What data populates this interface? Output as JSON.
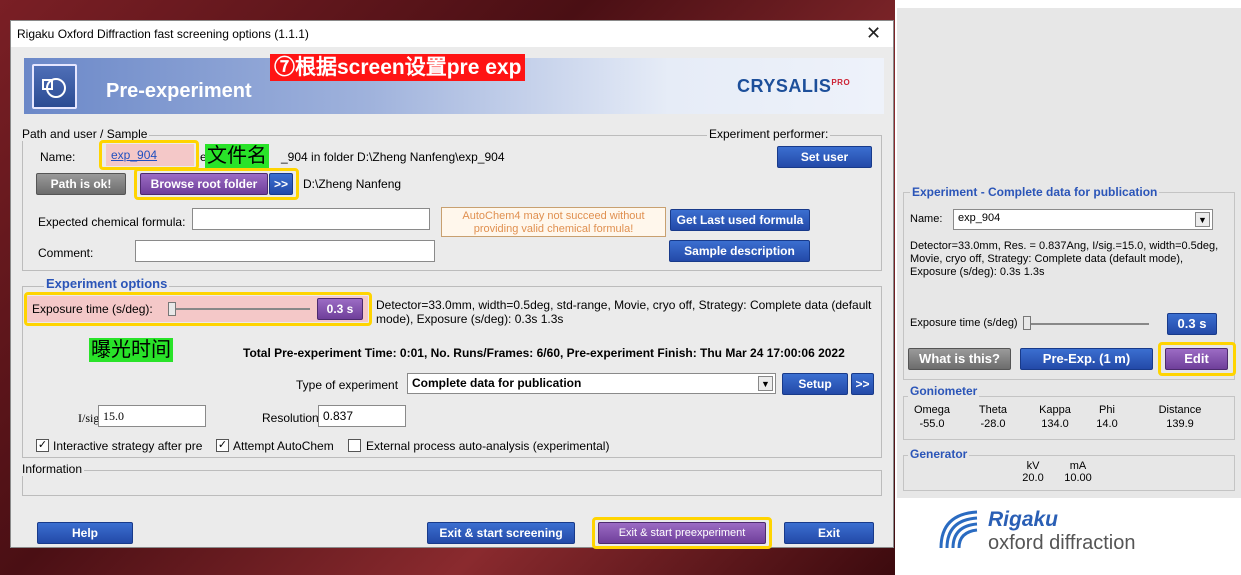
{
  "dialog": {
    "title": "Rigaku Oxford Diffraction fast screening options (1.1.1)",
    "close_icon": "close-icon",
    "banner_title": "Pre-experiment",
    "brand_logo": "CRYSALIS",
    "brand_sup": "PRO",
    "annotation_top": "⑦根据screen设置pre exp"
  },
  "path": {
    "group_label": "Path and user / Sample",
    "performer_label": "Experiment performer:",
    "name_label": "Name:",
    "name_value": "exp_904",
    "annotation_filename": "文件名",
    "path_desc": "exp_904 in folder D:\\Zheng Nanfeng\\exp_904",
    "path_desc_prefix": "e",
    "path_desc_suffix": "_904 in folder D:\\Zheng Nanfeng\\exp_904",
    "set_user": "Set user",
    "path_ok": "Path is ok!",
    "browse_root": "Browse root folder",
    "browse_more": ">>",
    "root_path": "D:\\Zheng Nanfeng",
    "formula_label": "Expected chemical formula:",
    "formula_value": "",
    "autochem_warning": "AutoChem4 may not succeed without providing valid chemical formula!",
    "last_formula": "Get Last used formula",
    "comment_label": "Comment:",
    "comment_value": "",
    "sample_desc": "Sample description"
  },
  "experiment": {
    "group_label": "Experiment options",
    "exposure_label": "Exposure time (s/deg):",
    "exposure_value": "0.3 s",
    "detector_text_1": "Detector=33.0mm, width=0.5deg, std-range, Movie, cryo off, Strategy: Complete data (default",
    "detector_text_2": "mode), Exposure (s/deg): 0.3s 1.3s",
    "annotation_exposure": "曝光时间",
    "total_text": "Total Pre-experiment Time: 0:01, No. Runs/Frames: 6/60, Pre-experiment Finish: Thu Mar 24 17:00:06 2022",
    "type_label": "Type of experiment",
    "type_value": "Complete data for publication",
    "setup": "Setup",
    "setup_more": ">>",
    "isig_label": "I/sig",
    "isig_value": "15.0",
    "resolution_label": "Resolution",
    "resolution_value": "0.837",
    "check_interactive": "Interactive strategy after pre",
    "check_autochem": "Attempt AutoChem",
    "check_external": "External process auto-analysis (experimental)",
    "checkmark": "✓"
  },
  "information": {
    "group_label": "Information"
  },
  "footer": {
    "help": "Help",
    "exit_screening": "Exit & start screening",
    "exit_preexp": "Exit & start preexperiment",
    "exit": "Exit"
  },
  "right_panel": {
    "experiment_header": "Experiment - Complete data for publication",
    "name_label": "Name:",
    "name_value": "exp_904",
    "details": "Detector=33.0mm, Res. = 0.837Ang, I/sig.=15.0, width=0.5deg, Movie, cryo off, Strategy: Complete data (default mode), Exposure (s/deg): 0.3s 1.3s",
    "exposure_label": "Exposure time (s/deg)",
    "exposure_value": "0.3 s",
    "what_is_this": "What is this?",
    "pre_exp": "Pre-Exp. (1 m)",
    "edit": "Edit",
    "goniometer_header": "Goniometer",
    "gonio_labels": [
      "Omega",
      "Theta",
      "Kappa",
      "Phi",
      "Distance"
    ],
    "gonio_values": [
      "-55.0",
      "-28.0",
      "134.0",
      "14.0",
      "139.9"
    ],
    "generator_header": "Generator",
    "gen_labels": [
      "kV",
      "mA"
    ],
    "gen_values": [
      "20.0",
      "10.00"
    ],
    "brand_name": "Rigaku",
    "brand_sub": "oxford diffraction"
  },
  "colors": {
    "accent_blue": "#2349a8",
    "highlight_yellow": "#ffd400",
    "annotation_red": "#ff1414",
    "annotation_green": "#29e329",
    "purple_button": "#6f3f9a"
  }
}
